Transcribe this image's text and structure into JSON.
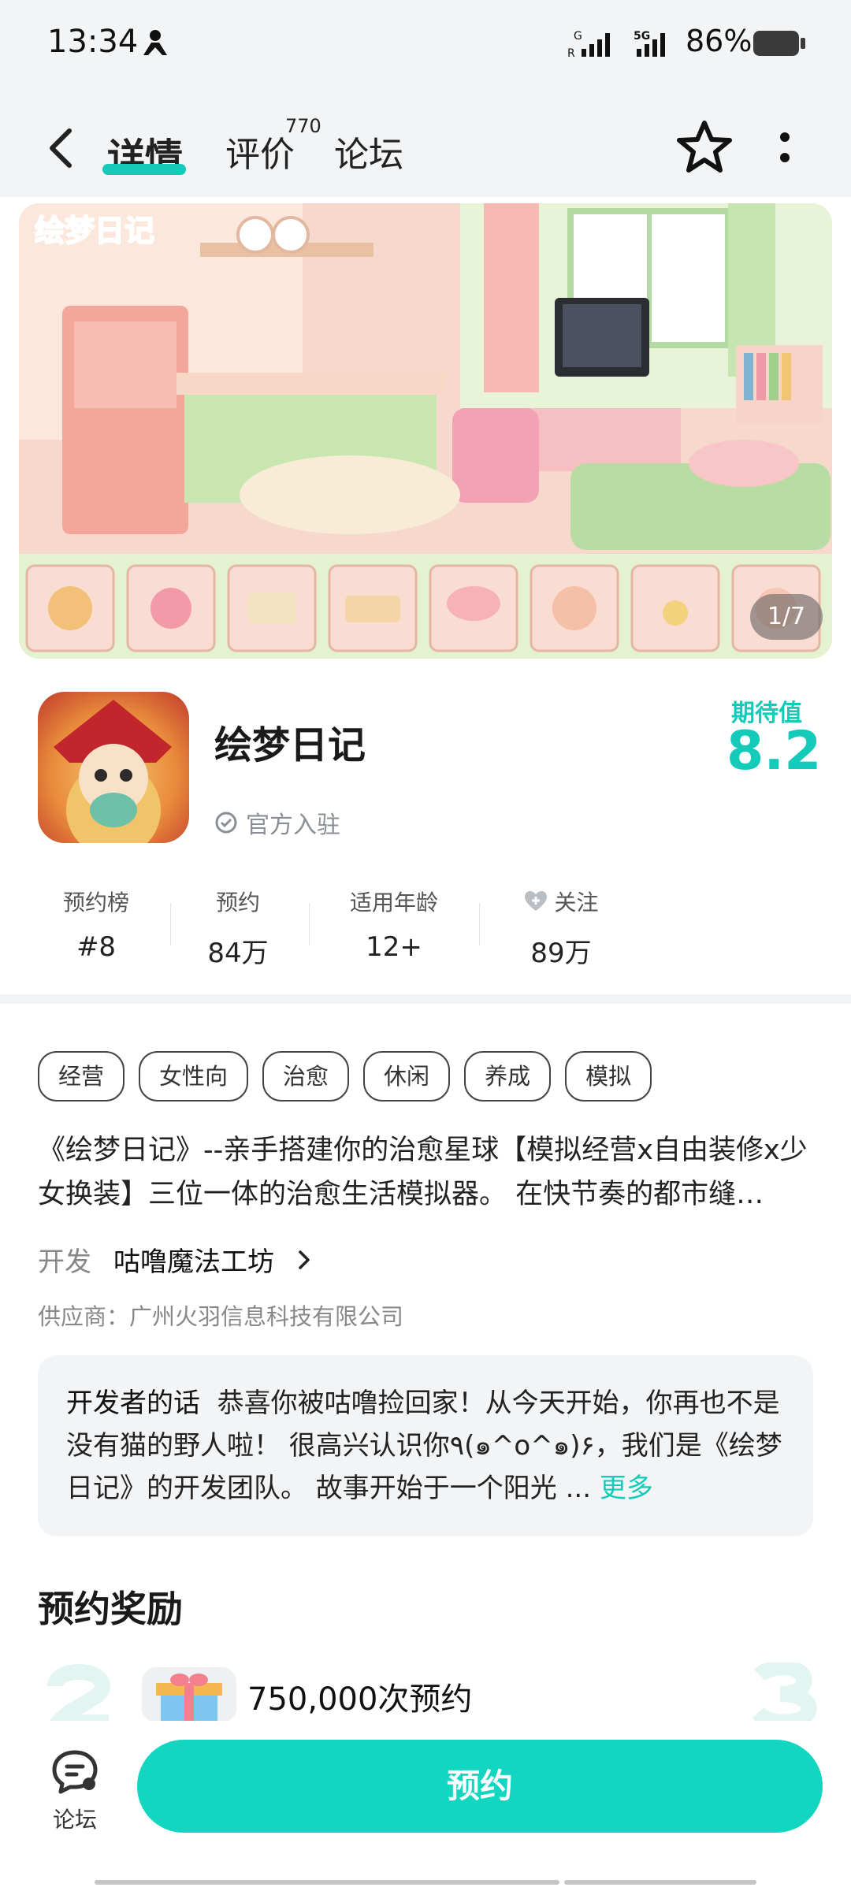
{
  "status_bar": {
    "time": "13:34",
    "battery": "86%"
  },
  "nav": {
    "tabs": [
      "详情",
      "评价",
      "论坛"
    ],
    "review_count": "770"
  },
  "banner": {
    "title_art": "绘梦日记",
    "page_indicator": "1/7"
  },
  "app": {
    "name": "绘梦日记",
    "official_badge": "官方入驻",
    "expectation_label": "期待值",
    "expectation_score": "8.2"
  },
  "stats": [
    {
      "label": "预约榜",
      "value": "#8"
    },
    {
      "label": "预约",
      "value": "84万"
    },
    {
      "label": "适用年龄",
      "value": "12+"
    },
    {
      "label": "关注",
      "value": "89万"
    }
  ],
  "tags": [
    "经营",
    "女性向",
    "治愈",
    "休闲",
    "养成",
    "模拟"
  ],
  "description": "《绘梦日记》--亲手搭建你的治愈星球【模拟经营x自由装修x少女换装】三位一体的治愈生活模拟器。 在快节奏的都市缝…",
  "developer": {
    "label": "开发",
    "name": "咕噜魔法工坊",
    "supplier": "供应商：广州火羽信息科技有限公司"
  },
  "developer_words": {
    "title": "开发者的话",
    "text": "恭喜你被咕噜捡回家！从今天开始，你再也不是没有猫的野人啦！ 很高兴认识你٩(๑^o^๑)۶，我们是《绘梦日记》的开发团队。 故事开始于一个阳光 ...",
    "more": "更多"
  },
  "rewards": {
    "title": "预约奖励",
    "item_text": "750,000次预约"
  },
  "bottom": {
    "forum_label": "论坛",
    "reserve_label": "预约"
  },
  "colors": {
    "accent": "#13cbb8",
    "button": "#13d6c1",
    "background_band": "#f3f4f6"
  }
}
